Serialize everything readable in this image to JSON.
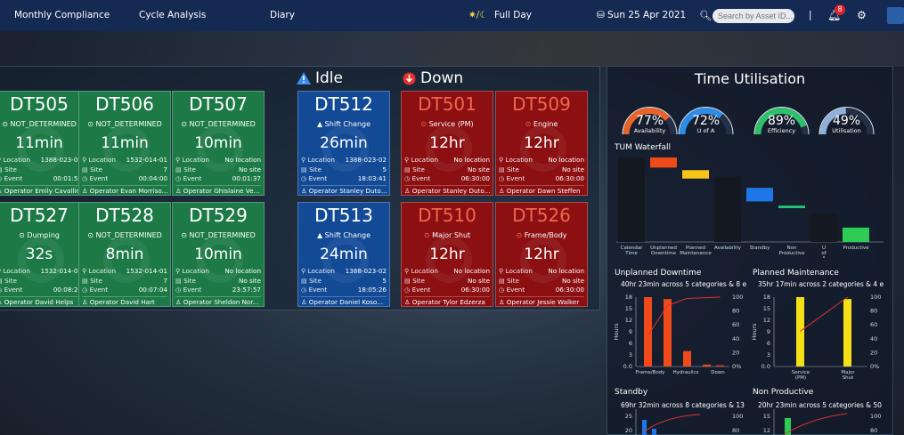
{
  "nav": {
    "items": [
      "Monthly Compliance",
      "Cycle Analysis",
      "Diary"
    ],
    "shift": "Full Day",
    "date": "Sun 25 Apr 2021",
    "search_placeholder": "Search by Asset ID...",
    "separator": "|",
    "notif_count": "8"
  },
  "headers": {
    "idle": "Idle",
    "down": "Down"
  },
  "cards": [
    {
      "id": "DT505",
      "status": "NOT_DETERMINED",
      "dur": "11min",
      "loc": "1388-023-02",
      "site": "5",
      "event": "00:01:57",
      "op": "Emily Cavallin"
    },
    {
      "id": "DT506",
      "status": "NOT_DETERMINED",
      "dur": "11min",
      "loc": "1532-014-01",
      "site": "7",
      "event": "00:04:00",
      "op": "Evan Morriso..."
    },
    {
      "id": "DT507",
      "status": "NOT_DETERMINED",
      "dur": "10min",
      "loc": "No location",
      "site": "No site",
      "event": "00:01:37",
      "op": "Ghislaine Ve..."
    },
    {
      "id": "DT527",
      "status": "Dumping",
      "dur": "32s",
      "loc": "1532-014-01",
      "site": "7",
      "event": "00:08:21",
      "op": "David Helps"
    },
    {
      "id": "DT528",
      "status": "NOT_DETERMINED",
      "dur": "8min",
      "loc": "1532-014-01",
      "site": "7",
      "event": "00:07:04",
      "op": "David Hart"
    },
    {
      "id": "DT529",
      "status": "NOT_DETERMINED",
      "dur": "10min",
      "loc": "No location",
      "site": "No site",
      "event": "23:57:57",
      "op": "Sheldon Nor..."
    },
    {
      "id": "DT512",
      "status": "Shift Change",
      "dur": "26min",
      "loc": "1388-023-02",
      "site": "5",
      "event": "18:03:41",
      "op": "Stanley Duto..."
    },
    {
      "id": "DT513",
      "status": "Shift Change",
      "dur": "24min",
      "loc": "1388-023-02",
      "site": "5",
      "event": "18:05:26",
      "op": "Daniel Koso..."
    },
    {
      "id": "DT501",
      "status": "Service (PM)",
      "dur": "12hr",
      "loc": "No location",
      "site": "No site",
      "event": "06:30:00",
      "op": "Stanley Duto..."
    },
    {
      "id": "DT509",
      "status": "Engine",
      "dur": "12hr",
      "loc": "No location",
      "site": "No site",
      "event": "06:30:00",
      "op": "Dawn Steffen"
    },
    {
      "id": "DT510",
      "status": "Major Shut",
      "dur": "12hr",
      "loc": "No location",
      "site": "No site",
      "event": "06:30:00",
      "op": "Tylor Edzerza"
    },
    {
      "id": "DT526",
      "status": "Frame/Body",
      "dur": "12hr",
      "loc": "No location",
      "site": "No site",
      "event": "06:30:00",
      "op": "Jessie Walker"
    }
  ],
  "field_labels": {
    "location": "Location",
    "site": "Site",
    "event": "Event",
    "operator": "Operator"
  },
  "time_util": {
    "title": "Time Utilisation",
    "gauges": [
      {
        "value": "77%",
        "label": "Availability",
        "pct": 77,
        "color": "#e8632a"
      },
      {
        "value": "72%",
        "label": "U of A",
        "pct": 72,
        "color": "#2e8ce6"
      },
      {
        "value": "89%",
        "label": "Efficiency",
        "pct": 89,
        "color": "#2fbf6a"
      },
      {
        "value": "49%",
        "label": "Utilisation",
        "pct": 49,
        "color": "#8fb0d8"
      }
    ]
  },
  "chart_data": [
    {
      "type": "bar",
      "title": "TUM Waterfall",
      "categories": [
        "Calendar Time",
        "Unplanned Downtime",
        "Planned Maintenance",
        "Availability",
        "Standby",
        "Non Productive",
        "U of A",
        "Productive"
      ],
      "ranges": [
        [
          0,
          100
        ],
        [
          88,
          100
        ],
        [
          75,
          85
        ],
        [
          0,
          77
        ],
        [
          48,
          64
        ],
        [
          40,
          43
        ],
        [
          0,
          34
        ],
        [
          0,
          17
        ]
      ],
      "ylim": [
        0,
        100
      ]
    },
    {
      "type": "bar",
      "title": "Unplanned Downtime",
      "subtitle": "40hr 23min across 5 categories & 8 e",
      "ylabel": "Hours",
      "categories": [
        "Frame/Body",
        "Hydraulics",
        "Down"
      ],
      "values": [
        18,
        17.5,
        4,
        0.5,
        0.3
      ],
      "ylim": [
        0,
        18
      ],
      "yticks": [
        "18",
        "15",
        "12",
        "9",
        "6",
        "3",
        "0.0"
      ],
      "y2ticks": [
        "100",
        "80",
        "60",
        "40",
        "20",
        "0%"
      ]
    },
    {
      "type": "bar",
      "title": "Planned Maintenance",
      "subtitle": "35hr 17min across 2 categories & 4 e",
      "ylabel": "Hours",
      "categories": [
        "Service (PM)",
        "Major Shut"
      ],
      "values": [
        18,
        17.5
      ],
      "ylim": [
        0,
        18
      ],
      "yticks": [
        "18",
        "15",
        "12",
        "9",
        "6",
        "3",
        "0.0"
      ],
      "y2ticks": [
        "100",
        "80",
        "60",
        "40",
        "20",
        "0%"
      ]
    },
    {
      "type": "bar",
      "title": "Standby",
      "subtitle": "69hr 32min across 8 categories & 13",
      "yticks": [
        "25",
        "20"
      ],
      "y2ticks": [
        "100",
        "80"
      ]
    },
    {
      "type": "bar",
      "title": "Non Productive",
      "subtitle": "20hr 23min across 5 categories & 50",
      "yticks": [
        "15",
        "12"
      ],
      "y2ticks": [
        "100",
        "80"
      ]
    }
  ]
}
